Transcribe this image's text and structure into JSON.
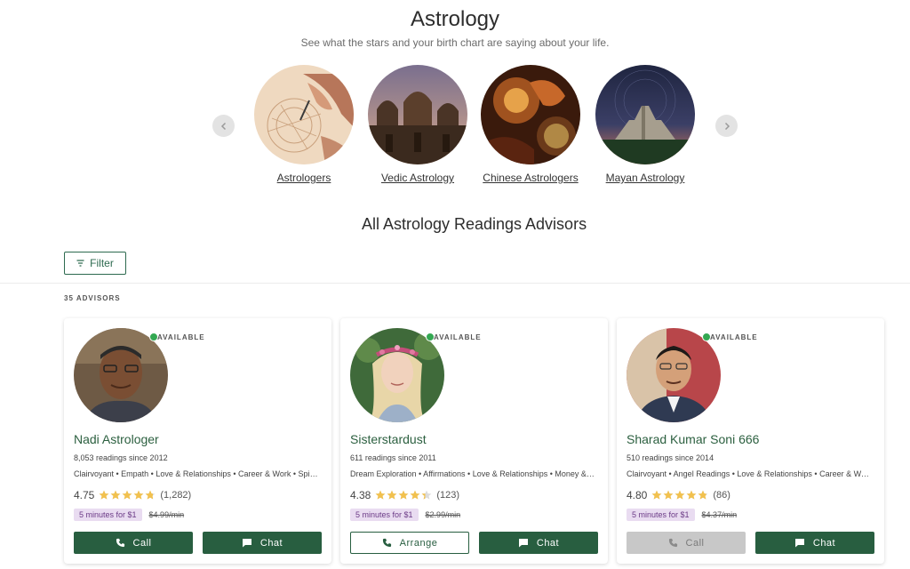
{
  "header": {
    "title": "Astrology",
    "subtitle": "See what the stars and your birth chart are saying about your life."
  },
  "categories": [
    {
      "label": "Astrologers",
      "icon": "hand-drawing-image"
    },
    {
      "label": "Vedic Astrology",
      "icon": "indian-temple-image"
    },
    {
      "label": "Chinese Astrologers",
      "icon": "dragon-statue-image"
    },
    {
      "label": "Mayan Astrology",
      "icon": "mayan-pyramid-image"
    }
  ],
  "section": {
    "title": "All Astrology Readings Advisors",
    "filter_label": "Filter",
    "count_label": "35 ADVISORS"
  },
  "advisors": [
    {
      "status": "AVAILABLE",
      "name": "Nadi Astrologer",
      "since": "8,053 readings since 2012",
      "tags": "Clairvoyant • Empath • Love & Relationships • Career & Work • Spiritual Guidance",
      "rating": "4.75",
      "stars": 4.75,
      "reviews": "(1,282)",
      "promo": "5 minutes for $1",
      "old_price": "$4.99/min",
      "btn1": "Call",
      "btn2": "Chat"
    },
    {
      "status": "AVAILABLE",
      "name": "Sisterstardust",
      "since": "611 readings since 2011",
      "tags": "Dream Exploration • Affirmations • Love & Relationships • Money & Finance",
      "rating": "4.38",
      "stars": 4.38,
      "reviews": "(123)",
      "promo": "5 minutes for $1",
      "old_price": "$2.99/min",
      "btn1": "Arrange",
      "btn2": "Chat"
    },
    {
      "status": "AVAILABLE",
      "name": "Sharad Kumar Soni 666",
      "since": "510 readings since 2014",
      "tags": "Clairvoyant • Angel Readings • Love & Relationships • Career & Work",
      "rating": "4.80",
      "stars": 4.8,
      "reviews": "(86)",
      "promo": "5 minutes for $1",
      "old_price": "$4.37/min",
      "btn1": "Call",
      "btn2": "Chat"
    }
  ],
  "colors": {
    "brand": "#285e40",
    "star": "#f2c14e",
    "available": "#33a852",
    "promo_bg": "#e9dcf1"
  }
}
